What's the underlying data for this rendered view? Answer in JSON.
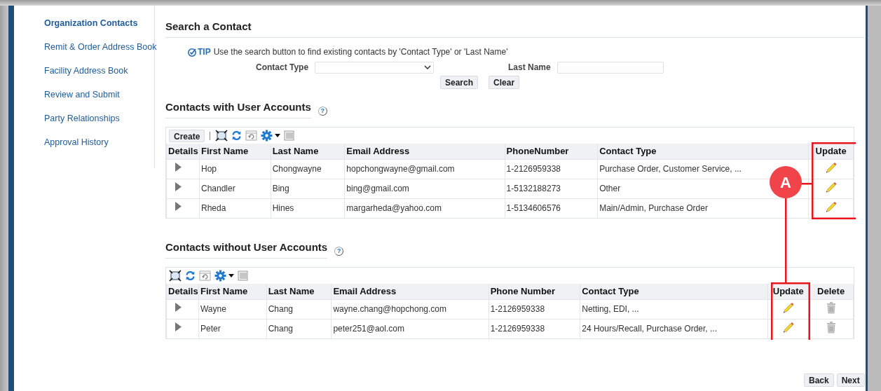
{
  "sidebar": {
    "items": [
      {
        "label": "Organization Contacts",
        "selected": true
      },
      {
        "label": "Remit & Order Address Book",
        "selected": false
      },
      {
        "label": "Facility Address Book",
        "selected": false
      },
      {
        "label": "Review and Submit",
        "selected": false
      },
      {
        "label": "Party Relationships",
        "selected": false
      },
      {
        "label": "Approval History",
        "selected": false
      }
    ]
  },
  "search": {
    "title": "Search a Contact",
    "tip_label": "TIP",
    "tip_text": "Use the search button to find existing contacts by 'Contact Type' or 'Last Name'",
    "contact_type_label": "Contact Type",
    "last_name_label": "Last Name",
    "buttons": [
      "Search",
      "Clear"
    ]
  },
  "tables": [
    {
      "title": "Contacts with User Accounts",
      "help": "?",
      "create_button": "Create",
      "columns": [
        {
          "label": "Details",
          "kind": "details"
        },
        {
          "label": "First Name",
          "kind": "text"
        },
        {
          "label": "Last Name",
          "kind": "text"
        },
        {
          "label": "Email Address",
          "kind": "text"
        },
        {
          "label": "PhoneNumber",
          "kind": "text"
        },
        {
          "label": "Contact Type",
          "kind": "text"
        },
        {
          "label": "Update",
          "kind": "update"
        }
      ],
      "rows": [
        [
          "",
          "Hop",
          "Chongwayne",
          "hopchongwayne@gmail.com",
          "1-2126959338",
          "Purchase Order, Customer Service, ..."
        ],
        [
          "",
          "Chandler",
          "Bing",
          "bing@gmail.com",
          "1-5132188273",
          "Other"
        ],
        [
          "",
          "Rheda",
          "Hines",
          "margarheda@yahoo.com",
          "1-5134606576",
          "Main/Admin, Purchase Order"
        ]
      ]
    },
    {
      "title": "Contacts without User Accounts",
      "help": "?",
      "columns": [
        {
          "label": "Details",
          "kind": "details"
        },
        {
          "label": "First Name",
          "kind": "text"
        },
        {
          "label": "Last Name",
          "kind": "text"
        },
        {
          "label": "Email Address",
          "kind": "text"
        },
        {
          "label": "Phone Number",
          "kind": "text"
        },
        {
          "label": "Contact Type",
          "kind": "text"
        },
        {
          "label": "Update",
          "kind": "update"
        },
        {
          "label": "Delete",
          "kind": "delete"
        }
      ],
      "rows": [
        [
          "",
          "Wayne",
          "Chang",
          "wayne.chang@hopchong.com",
          "1-2126959338",
          "Netting, EDI, ..."
        ],
        [
          "",
          "Peter",
          "Chang",
          "peter251@aol.com",
          "1-2126959338",
          "24 Hours/Recall, Purchase Order, ..."
        ]
      ]
    }
  ],
  "callout": {
    "label": "A"
  },
  "footer_buttons": [
    "Back",
    "Next"
  ]
}
